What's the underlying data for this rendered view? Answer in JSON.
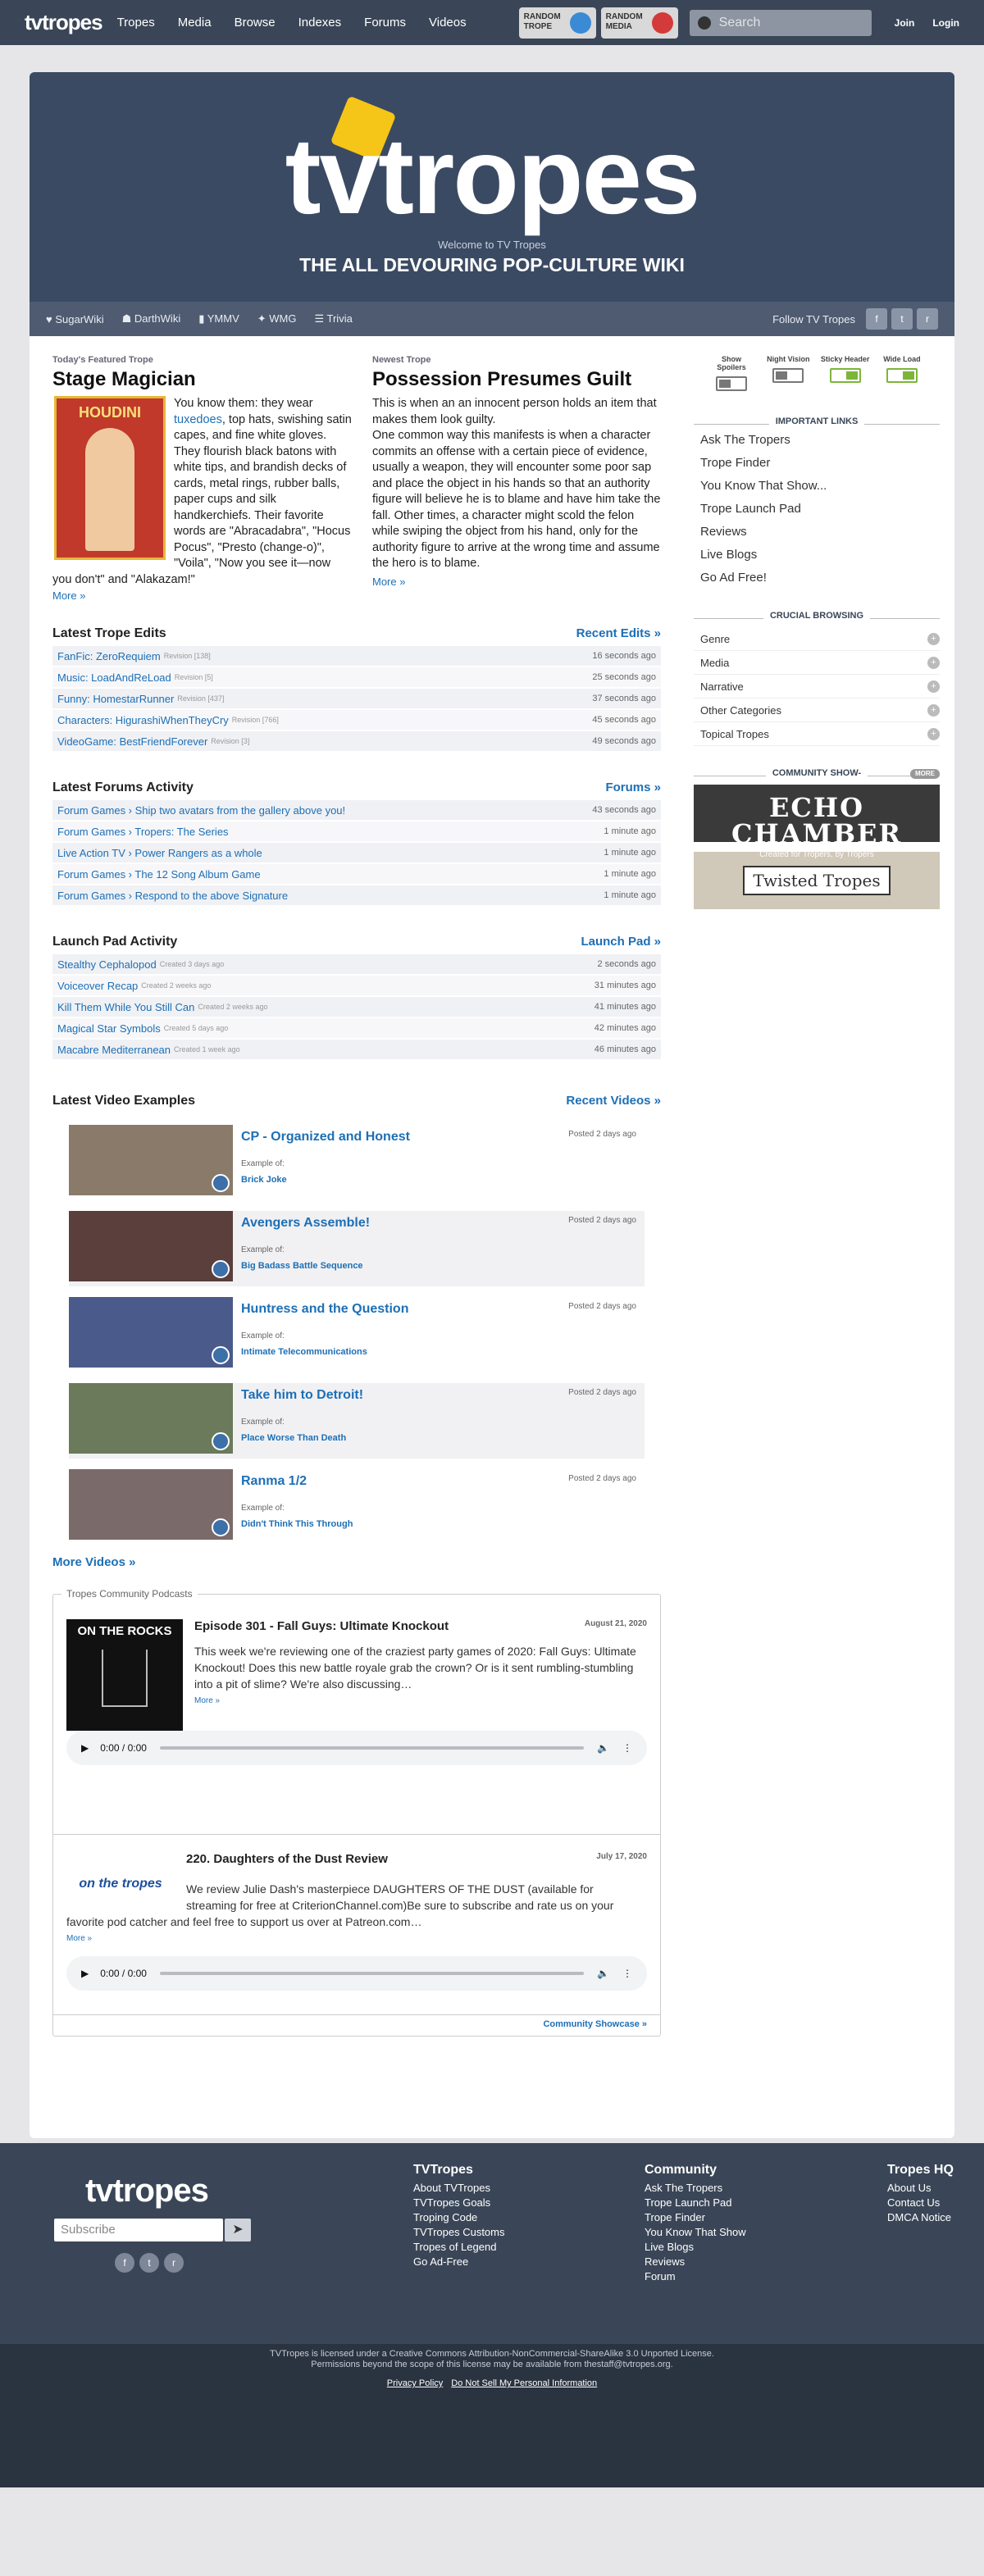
{
  "nav": {
    "logo": "tvtropes",
    "links": [
      "Tropes",
      "Media",
      "Browse",
      "Indexes",
      "Forums",
      "Videos"
    ],
    "random_trope": "RANDOM TROPE",
    "random_media": "RANDOM MEDIA",
    "search_placeholder": "Search",
    "join": "Join",
    "login": "Login"
  },
  "hero": {
    "logo": "tvtropes",
    "welcome": "Welcome to TV Tropes",
    "tagline": "THE ALL DEVOURING POP-CULTURE WIKI"
  },
  "subbar": {
    "links": [
      "SugarWiki",
      "DarthWiki",
      "YMMV",
      "WMG",
      "Trivia"
    ],
    "follow": "Follow TV Tropes"
  },
  "featured": {
    "kicker": "Today's Featured Trope",
    "title": "Stage Magician",
    "image_label": "HOUDINI",
    "text_pre": "You know them: they wear ",
    "link": "tuxedoes",
    "text_post": ", top hats, swishing satin capes, and fine white gloves. They flourish black batons with white tips, and brandish decks of cards, metal rings, rubber balls, paper cups and silk handkerchiefs. Their favorite words are \"Abracadabra\", \"Hocus Pocus\", \"Presto (change-o)\", \"Voila\", \"Now you see it—now you don't\" and \"Alakazam!\"",
    "more": "More »"
  },
  "newest": {
    "kicker": "Newest Trope",
    "title": "Possession Presumes Guilt",
    "p1": "This is when an an innocent person holds an item that makes them look guilty.",
    "p2": "One common way this manifests is when a character commits an offense with a certain piece of evidence, usually a weapon, they will encounter some poor sap and place the object in his hands so that an authority figure will believe he is to blame and have him take the fall. Other times, a character might scold the felon while swiping the object from his hand, only for the authority figure to arrive at the wrong time and assume the hero is to blame.",
    "more": "More »"
  },
  "edits": {
    "title": "Latest Trope Edits",
    "link": "Recent Edits »",
    "rows": [
      {
        "name": "FanFic: ZeroRequiem",
        "rev": "Revision [138]",
        "time": "16 seconds ago"
      },
      {
        "name": "Music: LoadAndReLoad",
        "rev": "Revision [5]",
        "time": "25 seconds ago"
      },
      {
        "name": "Funny: HomestarRunner",
        "rev": "Revision [437]",
        "time": "37 seconds ago"
      },
      {
        "name": "Characters: HigurashiWhenTheyCry",
        "rev": "Revision [766]",
        "time": "45 seconds ago"
      },
      {
        "name": "VideoGame: BestFriendForever",
        "rev": "Revision [3]",
        "time": "49 seconds ago"
      }
    ]
  },
  "forums": {
    "title": "Latest Forums Activity",
    "link": "Forums »",
    "rows": [
      {
        "name": "Forum Games › Ship two avatars from the gallery above you!",
        "time": "43 seconds ago"
      },
      {
        "name": "Forum Games › Tropers: The Series",
        "time": "1 minute ago"
      },
      {
        "name": "Live Action TV › Power Rangers as a whole",
        "time": "1 minute ago"
      },
      {
        "name": "Forum Games › The 12 Song Album Game",
        "time": "1 minute ago"
      },
      {
        "name": "Forum Games › Respond to the above Signature",
        "time": "1 minute ago"
      }
    ]
  },
  "launch": {
    "title": "Launch Pad Activity",
    "link": "Launch Pad »",
    "rows": [
      {
        "name": "Stealthy Cephalopod",
        "rev": "Created 3 days ago",
        "time": "2 seconds ago"
      },
      {
        "name": "Voiceover Recap",
        "rev": "Created 2 weeks ago",
        "time": "31 minutes ago"
      },
      {
        "name": "Kill Them While You Still Can",
        "rev": "Created 2 weeks ago",
        "time": "41 minutes ago"
      },
      {
        "name": "Magical Star Symbols",
        "rev": "Created 5 days ago",
        "time": "42 minutes ago"
      },
      {
        "name": "Macabre Mediterranean",
        "rev": "Created 1 week ago",
        "time": "46 minutes ago"
      }
    ]
  },
  "videos": {
    "title": "Latest Video Examples",
    "link": "Recent Videos »",
    "example_of": "Example of:",
    "more": "More Videos »",
    "items": [
      {
        "title": "CP - Organized and Honest",
        "posted": "Posted 2 days ago",
        "trope": "Brick Joke",
        "color": "#8a7a6a"
      },
      {
        "title": "Avengers Assemble!",
        "posted": "Posted 2 days ago",
        "trope": "Big Badass Battle Sequence",
        "color": "#5a3f3c"
      },
      {
        "title": "Huntress and the Question",
        "posted": "Posted 2 days ago",
        "trope": "Intimate Telecommunications",
        "color": "#4a5a8a"
      },
      {
        "title": "Take him to Detroit!",
        "posted": "Posted 2 days ago",
        "trope": "Place Worse Than Death",
        "color": "#6a7a5a"
      },
      {
        "title": "Ranma 1/2",
        "posted": "Posted 2 days ago",
        "trope": "Didn't Think This Through",
        "color": "#7a6a6a"
      }
    ]
  },
  "podcasts": {
    "label": "Tropes Community Podcasts",
    "showcase": "Community Showcase »",
    "episodes": [
      {
        "art": "ON THE ROCKS",
        "title": "Episode 301 - Fall Guys: Ultimate Knockout",
        "date": "August 21, 2020",
        "text": "This week we're reviewing one of the craziest party games of 2020: Fall Guys: Ultimate Knockout! Does this new battle royale grab the crown? Or is it sent rumbling-stumbling into a pit of slime? We're also discussing…",
        "more": "More »",
        "time": "0:00 / 0:00"
      },
      {
        "art": "on the tropes",
        "title": "220. Daughters of the Dust Review",
        "date": "July 17, 2020",
        "text": "We review Julie Dash's masterpiece DAUGHTERS OF THE DUST (available for streaming for free at CriterionChannel.com)Be sure to subscribe and rate us on your favorite pod catcher and feel free to support us over at Patreon.com…",
        "more": "More »",
        "time": "0:00 / 0:00"
      }
    ]
  },
  "sidebar": {
    "toggles": [
      {
        "label": "Show Spoilers",
        "on": false
      },
      {
        "label": "Night Vision",
        "on": false
      },
      {
        "label": "Sticky Header",
        "on": true
      },
      {
        "label": "Wide Load",
        "on": true
      }
    ],
    "important_title": "IMPORTANT LINKS",
    "important": [
      "Ask The Tropers",
      "Trope Finder",
      "You Know That Show...",
      "Trope Launch Pad",
      "Reviews",
      "Live Blogs",
      "Go Ad Free!"
    ],
    "crucial_title": "CRUCIAL BROWSING",
    "crucial": [
      "Genre",
      "Media",
      "Narrative",
      "Other Categories",
      "Topical Tropes"
    ],
    "community_title": "COMMUNITY SHOW-",
    "more_badge": "MORE",
    "echo": "ECHO CHAMBER",
    "echo_sub": "Created for Tropers, by Tropers",
    "twisted": "Twisted Tropes"
  },
  "footer": {
    "subscribe_placeholder": "Subscribe",
    "cols": [
      {
        "h": "TVTropes",
        "items": [
          "About TVTropes",
          "TVTropes Goals",
          "Troping Code",
          "TVTropes Customs",
          "Tropes of Legend",
          "Go Ad-Free"
        ]
      },
      {
        "h": "Community",
        "items": [
          "Ask The Tropers",
          "Trope Launch Pad",
          "Trope Finder",
          "You Know That Show",
          "Live Blogs",
          "Reviews",
          "Forum"
        ]
      },
      {
        "h": "Tropes HQ",
        "items": [
          "About Us",
          "Contact Us",
          "DMCA Notice"
        ]
      }
    ],
    "license1": "TVTropes is licensed under a Creative Commons Attribution-NonCommercial-ShareAlike 3.0 Unported License.",
    "license2": "Permissions beyond the scope of this license may be available from thestaff@tvtropes.org.",
    "privacy": "Privacy Policy",
    "donotsell": "Do Not Sell My Personal Information"
  }
}
